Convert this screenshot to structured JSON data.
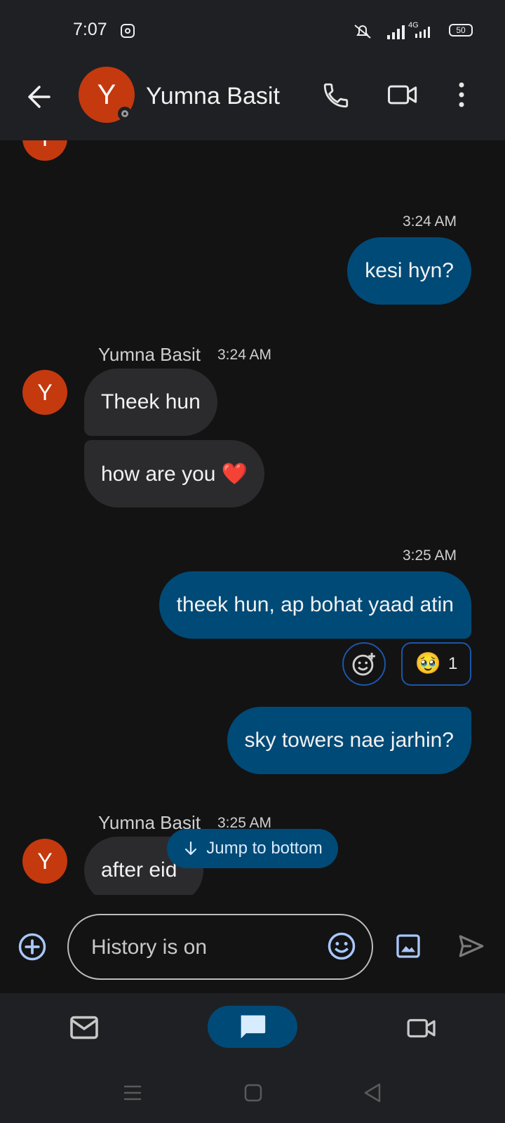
{
  "status_bar": {
    "time": "7:07",
    "network": "4G",
    "battery": "50"
  },
  "header": {
    "avatar_initial": "Y",
    "contact_name": "Yumna Basit",
    "icons": [
      "back-arrow-icon",
      "phone-icon",
      "video-call-icon",
      "more-vert-icon"
    ]
  },
  "messages": [
    {
      "direction": "outgoing",
      "time": "3:24 AM",
      "text": "kesi hyn?"
    },
    {
      "direction": "incoming",
      "sender": "Yumna Basit",
      "time": "3:24 AM",
      "avatar_initial": "Y",
      "texts": [
        "Theek hun",
        "how are you ❤️"
      ]
    },
    {
      "direction": "outgoing",
      "time": "3:25 AM",
      "text": "theek hun, ap bohat yaad atin",
      "reaction": {
        "emoji": "🥹",
        "count": "1"
      }
    },
    {
      "direction": "outgoing",
      "text": "sky towers nae jarhin?"
    },
    {
      "direction": "incoming",
      "sender": "Yumna Basit",
      "time": "3:25 AM",
      "avatar_initial": "Y",
      "texts": [
        "after eid"
      ]
    }
  ],
  "partial_avatar_initial": "Y",
  "jump_to_bottom": "Jump to bottom",
  "composer": {
    "placeholder": "History is on"
  },
  "colors": {
    "accent_blue": "#004a77",
    "avatar_orange": "#c5390f",
    "icon_blue": "#a8c7fa"
  }
}
